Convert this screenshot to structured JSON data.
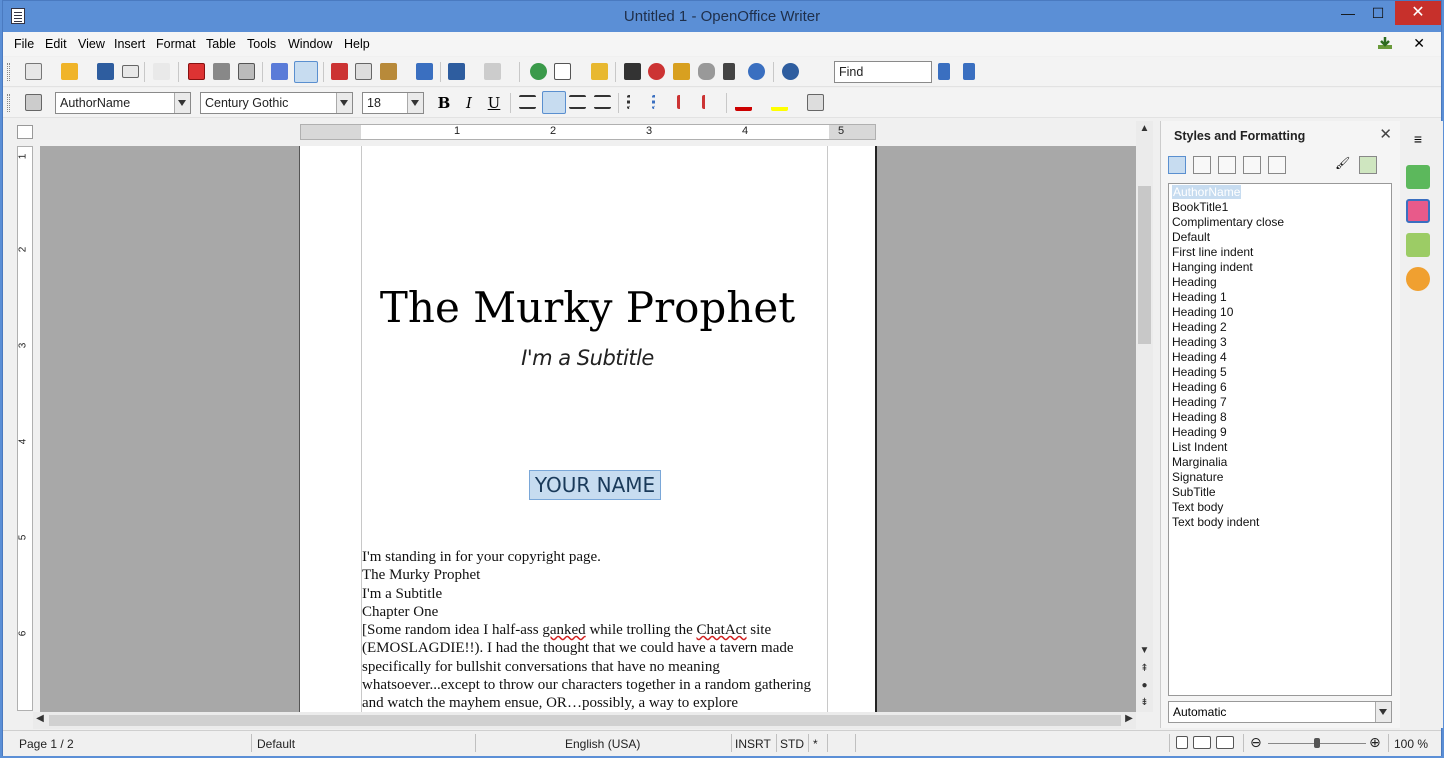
{
  "window": {
    "title": "Untitled 1 - OpenOffice Writer",
    "controls": {
      "minimize": "—",
      "maximize": "☐",
      "close": "✕"
    }
  },
  "menubar": {
    "items": [
      {
        "label": "File"
      },
      {
        "label": "Edit"
      },
      {
        "label": "View"
      },
      {
        "label": "Insert"
      },
      {
        "label": "Format"
      },
      {
        "label": "Table"
      },
      {
        "label": "Tools"
      },
      {
        "label": "Window"
      },
      {
        "label": "Help"
      }
    ],
    "close_doc": "✕"
  },
  "toolbar_standard": {
    "find_placeholder": "Find"
  },
  "toolbar_formatting": {
    "paragraph_style": "AuthorName",
    "font_name": "Century Gothic",
    "font_size": "18",
    "bold": "B",
    "italic": "I",
    "underline": "U"
  },
  "ruler": {
    "h_numbers": [
      "1",
      "2",
      "3",
      "4",
      "5"
    ],
    "v_numbers": [
      "1",
      "2",
      "3",
      "4",
      "5",
      "6"
    ]
  },
  "document": {
    "book_title": "The Murky Prophet",
    "subtitle": "I'm a Subtitle",
    "author_name": "YOUR NAME",
    "body_lines": [
      "I'm standing in for your copyright page.",
      "The Murky Prophet",
      "I'm a Subtitle",
      "Chapter One"
    ],
    "paragraph_start": "[Some random idea I half-ass ",
    "squiggle_1": "ganked",
    "paragraph_mid1": " while trolling the ",
    "squiggle_2": "ChatAct",
    "paragraph_rest": " site (EMOSLAGDIE!!). I had the thought that we could have a tavern made specifically for bullshit conversations that have no meaning whatsoever...except to throw our characters together in a random gathering and watch the mayhem ensue, OR…possibly, a way to explore"
  },
  "styles_panel": {
    "title": "Styles and Formatting",
    "styles": [
      "AuthorName",
      "BookTitle1",
      "Complimentary close",
      "Default",
      "First line indent",
      "Hanging indent",
      "Heading",
      "Heading 1",
      "Heading 10",
      "Heading 2",
      "Heading 3",
      "Heading 4",
      "Heading 5",
      "Heading 6",
      "Heading 7",
      "Heading 8",
      "Heading 9",
      "List Indent",
      "Marginalia",
      "Signature",
      "SubTitle",
      "Text body",
      "Text body indent"
    ],
    "selected": "AuthorName",
    "filter": "Automatic"
  },
  "statusbar": {
    "page": "Page 1 / 2",
    "page_style": "Default",
    "language": "English (USA)",
    "insert_mode": "INSRT",
    "selection_mode": "STD",
    "modified": "*",
    "zoom": "100 %"
  },
  "colors": {
    "titlebar": "#5b8fd6",
    "selection": "#c7dcf0",
    "canvas": "#a8a8a8"
  }
}
